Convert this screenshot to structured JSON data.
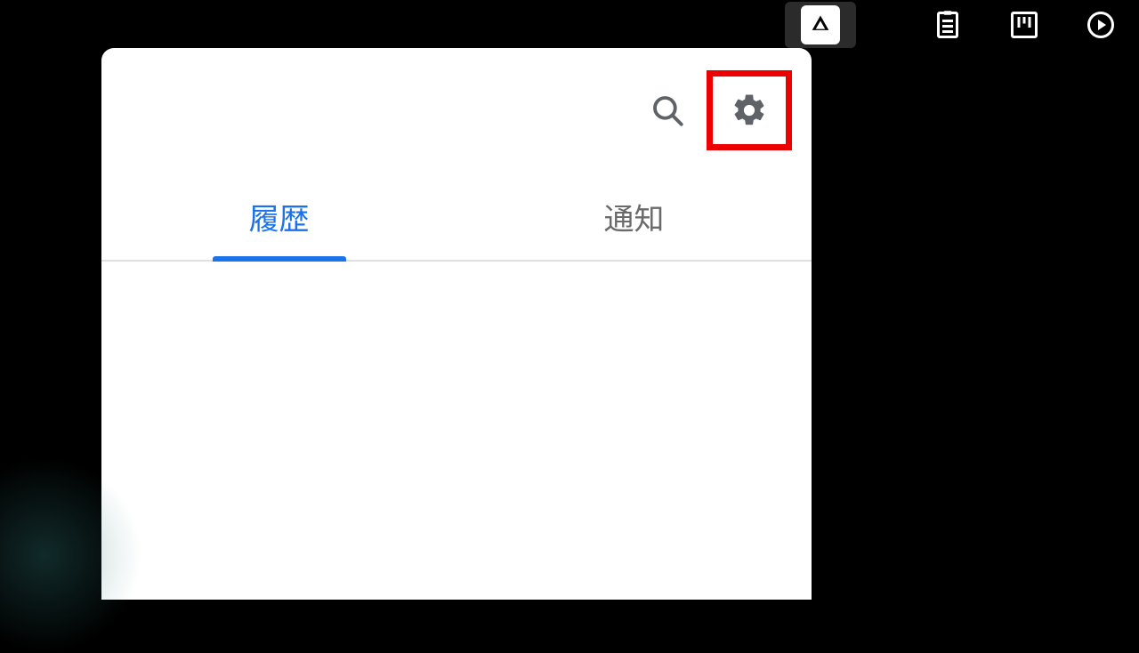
{
  "system_bar": {
    "items": [
      {
        "name": "drive-icon"
      },
      {
        "name": "clipboard-icon"
      },
      {
        "name": "board-icon"
      },
      {
        "name": "play-icon"
      }
    ]
  },
  "header": {
    "search_label": "検索",
    "settings_label": "設定"
  },
  "tabs": [
    {
      "id": "history",
      "label": "履歴",
      "active": true
    },
    {
      "id": "notifications",
      "label": "通知",
      "active": false
    }
  ],
  "highlight": "settings-button",
  "colors": {
    "accent": "#1a73e8",
    "highlight_border": "#ee0000"
  }
}
